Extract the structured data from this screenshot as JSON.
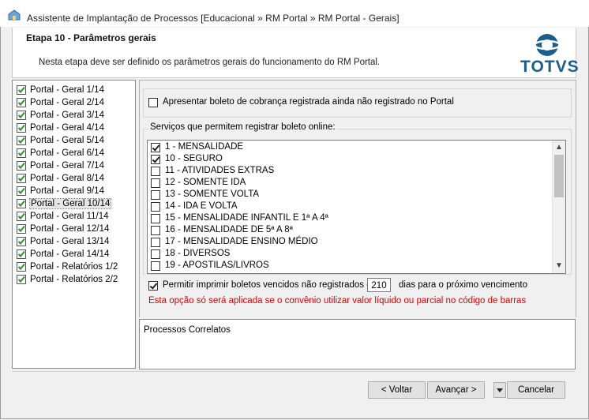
{
  "window": {
    "title": "Assistente de Implantação de Processos [Educacional » RM Portal » RM Portal - Gerais]"
  },
  "header": {
    "step_title": "Etapa 10 - Parâmetros gerais",
    "description": "Nesta etapa deve ser definido os parâmetros gerais do funcionamento do RM Portal.",
    "logo_text": "TOTVS",
    "brand_color": "#1b5d8f"
  },
  "nav": {
    "items": [
      {
        "label": "Portal - Geral 1/14",
        "checked": true
      },
      {
        "label": "Portal - Geral 2/14",
        "checked": true
      },
      {
        "label": "Portal - Geral 3/14",
        "checked": true
      },
      {
        "label": "Portal - Geral 4/14",
        "checked": true
      },
      {
        "label": "Portal - Geral 5/14",
        "checked": true
      },
      {
        "label": "Portal - Geral 6/14",
        "checked": true
      },
      {
        "label": "Portal - Geral 7/14",
        "checked": true
      },
      {
        "label": "Portal - Geral 8/14",
        "checked": true
      },
      {
        "label": "Portal - Geral 9/14",
        "checked": true
      },
      {
        "label": "Portal - Geral 10/14",
        "checked": true,
        "selected": true
      },
      {
        "label": "Portal - Geral 11/14",
        "checked": true
      },
      {
        "label": "Portal - Geral 12/14",
        "checked": true
      },
      {
        "label": "Portal - Geral 13/14",
        "checked": true
      },
      {
        "label": "Portal - Geral 14/14",
        "checked": true
      },
      {
        "label": "Portal - Relatórios 1/2",
        "checked": true
      },
      {
        "label": "Portal - Relatórios 2/2",
        "checked": true
      }
    ]
  },
  "options": {
    "show_registered_boleto_label": "Apresentar boleto de cobrança registrada ainda não registrado no Portal",
    "show_registered_boleto_checked": false
  },
  "services": {
    "group_title": "Serviços que permitem registrar boleto online:",
    "items": [
      {
        "label": "1 - MENSALIDADE",
        "checked": true
      },
      {
        "label": "10 - SEGURO",
        "checked": true
      },
      {
        "label": "11 - ATIVIDADES EXTRAS",
        "checked": false
      },
      {
        "label": "12 - SOMENTE IDA",
        "checked": false
      },
      {
        "label": "13 - SOMENTE VOLTA",
        "checked": false
      },
      {
        "label": "14 - IDA E VOLTA",
        "checked": false
      },
      {
        "label": "15 - MENSALIDADE INFANTIL E 1ª A 4ª",
        "checked": false
      },
      {
        "label": "16 - MENSALIDADE DE 5ª A 8ª",
        "checked": false
      },
      {
        "label": "17 - MENSALIDADE ENSINO MÉDIO",
        "checked": false
      },
      {
        "label": "18 - DIVERSOS",
        "checked": false
      },
      {
        "label": "19 - APOSTILAS/LIVROS",
        "checked": false
      }
    ]
  },
  "overdue": {
    "checked": true,
    "label_before": "Permitir imprimir boletos vencidos não registrados com",
    "days_value": "210",
    "label_after": "dias para o próximo vencimento",
    "warning": "Esta opção só será aplicada se o convênio utilizar valor líquido ou parcial no código de barras",
    "warning_color": "#e00000"
  },
  "related": {
    "title": "Processos Correlatos"
  },
  "buttons": {
    "back": "< Voltar",
    "next": "Avançar >",
    "cancel": "Cancelar"
  }
}
